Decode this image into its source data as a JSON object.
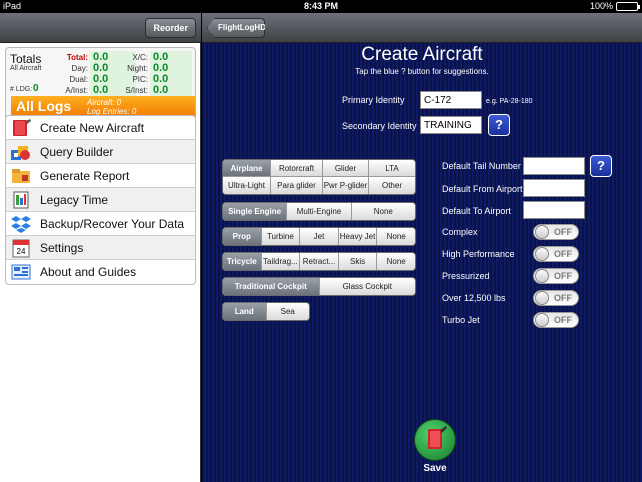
{
  "status_bar": {
    "device": "iPad",
    "time": "8:43 PM",
    "battery": "100%"
  },
  "left_nav": {
    "reorder_label": "Reorder"
  },
  "totals": {
    "title": "Totals",
    "subtitle": "All Aircraft",
    "ldg_label": "# LDG:",
    "ldg_value": "0",
    "stats": [
      {
        "label": "Total:",
        "value": "0.0"
      },
      {
        "label": "X/C:",
        "value": "0.0"
      },
      {
        "label": "Day:",
        "value": "0.0"
      },
      {
        "label": "Night:",
        "value": "0.0"
      },
      {
        "label": "Dual:",
        "value": "0.0"
      },
      {
        "label": "PIC:",
        "value": "0.0"
      },
      {
        "label": "A/Inst:",
        "value": "0.0"
      },
      {
        "label": "S/Inst:",
        "value": "0.0"
      }
    ]
  },
  "all_logs": {
    "title": "All Logs",
    "aircraft": "Aircraft: 0",
    "entries": "Log Entries: 0"
  },
  "menu": [
    {
      "label": "Create New Aircraft",
      "icon": "book-icon"
    },
    {
      "label": "Query Builder",
      "icon": "query-builder-icon"
    },
    {
      "label": "Generate Report",
      "icon": "report-icon"
    },
    {
      "label": "Legacy Time",
      "icon": "legacy-time-icon"
    },
    {
      "label": "Backup/Recover Your Data",
      "icon": "dropbox-icon"
    },
    {
      "label": "Settings",
      "icon": "calendar-icon"
    },
    {
      "label": "About and Guides",
      "icon": "guide-icon"
    }
  ],
  "right_nav": {
    "back_label": "FlightLogHD"
  },
  "form": {
    "title": "Create Aircraft",
    "subtitle": "Tap the blue ? button for suggestions.",
    "primary_label": "Primary Identity",
    "primary_value": "C-172",
    "primary_hint": "e.g. PA-28-180",
    "secondary_label": "Secondary Identity",
    "secondary_value": "TRAINING",
    "help_glyph": "?",
    "tail_label": "Default Tail Number",
    "from_label": "Default From Airport",
    "to_label": "Default To Airport",
    "save_label": "Save"
  },
  "segments": {
    "category": {
      "row1": [
        "Airplane",
        "Rotorcraft",
        "Glider",
        "LTA"
      ],
      "row2": [
        "Ultra-Light",
        "Para glider",
        "Pwr P-glider",
        "Other"
      ],
      "selected": "Airplane"
    },
    "engine": {
      "options": [
        "Single Engine",
        "Multi-Engine",
        "None"
      ],
      "selected": "Single Engine"
    },
    "engine_type": {
      "options": [
        "Prop",
        "Turbine",
        "Jet",
        "Heavy Jet",
        "None"
      ],
      "selected": "Prop"
    },
    "gear": {
      "options": [
        "Tricycle",
        "Taildrag...",
        "Retract...",
        "Skis",
        "None"
      ],
      "selected": "Tricycle"
    },
    "cockpit": {
      "options": [
        "Traditional Cockpit",
        "Glass Cockpit"
      ],
      "selected": "Traditional Cockpit"
    },
    "surface": {
      "options": [
        "Land",
        "Sea"
      ],
      "selected": "Land"
    }
  },
  "toggles": [
    {
      "label": "Complex",
      "state": "OFF"
    },
    {
      "label": "High Performance",
      "state": "OFF"
    },
    {
      "label": "Pressurized",
      "state": "OFF"
    },
    {
      "label": "Over 12,500 lbs",
      "state": "OFF"
    },
    {
      "label": "Turbo Jet",
      "state": "OFF"
    }
  ],
  "colors": {
    "accent_orange": "#f07800",
    "value_green": "#0a8a2a",
    "panel_blue": "#0c1a68"
  }
}
